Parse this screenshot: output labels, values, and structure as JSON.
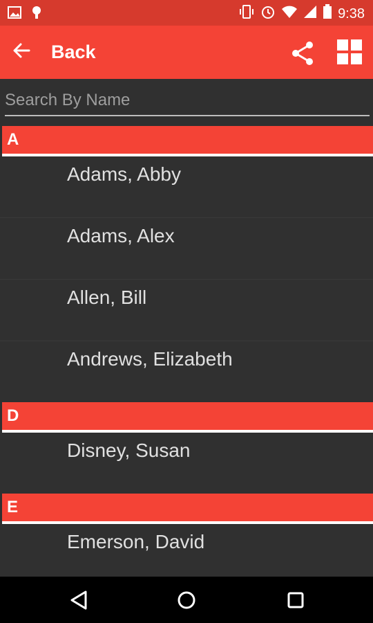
{
  "status_bar": {
    "time": "9:38",
    "left_icons": [
      "image-icon",
      "android-icon"
    ],
    "right_icons": [
      "vibrate-icon",
      "alarm-icon",
      "wifi-icon",
      "signal-icon",
      "battery-icon"
    ]
  },
  "app_bar": {
    "back_label": "Back",
    "actions": [
      "share-icon",
      "grid-icon"
    ],
    "color": "#f44336"
  },
  "search": {
    "placeholder": "Search By Name",
    "value": ""
  },
  "sections": [
    {
      "letter": "A",
      "contacts": [
        "Adams, Abby",
        "Adams, Alex",
        "Allen, Bill",
        "Andrews, Elizabeth"
      ]
    },
    {
      "letter": "D",
      "contacts": [
        "Disney, Susan"
      ]
    },
    {
      "letter": "E",
      "contacts": [
        "Emerson, David"
      ]
    }
  ],
  "nav_bar": {
    "buttons": [
      "back-icon",
      "home-icon",
      "recents-icon"
    ]
  }
}
